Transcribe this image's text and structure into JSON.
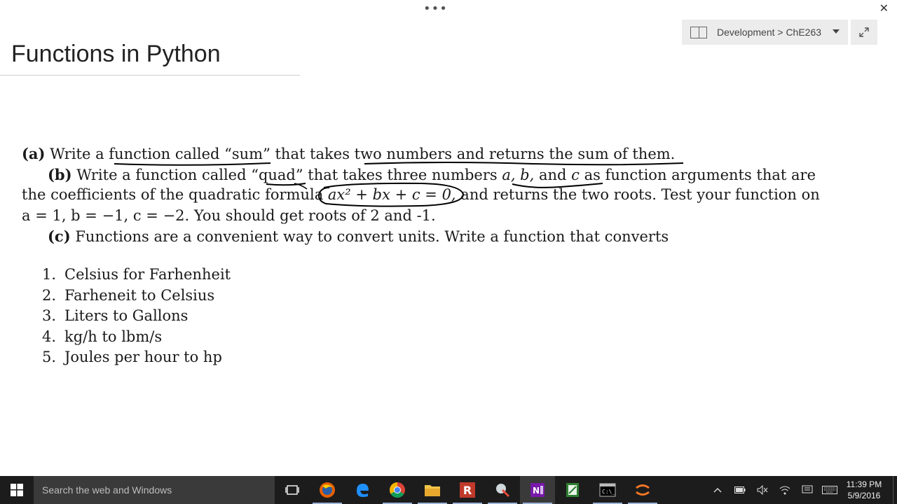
{
  "window": {
    "menu_dots": "•••",
    "close_glyph": "✕"
  },
  "notebook_picker": {
    "label": "Development > ChE263"
  },
  "page": {
    "title": "Functions in Python"
  },
  "content": {
    "a": {
      "tag": "(a)",
      "text": " Write a function called “sum” that takes two numbers and returns the sum of them."
    },
    "b": {
      "tag": "(b)",
      "l1": " Write a function called “quad” that takes three numbers ",
      "vars": "a, b,",
      "and": " and ",
      "c": "c",
      "l1_end": " as function arguments that are",
      "l2_start": "the coefficients of the quadratic formula ",
      "formula": "ax² + bx + c = 0,",
      "l2_end": " and returns the two roots. Test your function on",
      "l3": "a = 1, b = −1, c = −2. You should get roots of 2 and -1."
    },
    "c": {
      "tag": "(c)",
      "text": " Functions are a convenient way to convert units. Write a function that converts"
    },
    "list": [
      {
        "num": "1.",
        "text": "Celsius for Farhenheit"
      },
      {
        "num": "2.",
        "text": "Farheneit to Celsius"
      },
      {
        "num": "3.",
        "text": "Liters to Gallons"
      },
      {
        "num": "4.",
        "text": "kg/h to lbm/s"
      },
      {
        "num": "5.",
        "text": "Joules per hour to hp"
      }
    ]
  },
  "taskbar": {
    "search_placeholder": "Search the web and Windows",
    "apps": [
      "task-view",
      "firefox",
      "edge",
      "chrome",
      "file-explorer",
      "r",
      "ink-app",
      "onenote",
      "excel-calc",
      "command-prompt",
      "jupyter"
    ],
    "clock_time": "11:39 PM",
    "clock_date": "5/9/2016"
  },
  "colors": {
    "taskbar": "#1c1c1c",
    "ink": "#000000"
  }
}
